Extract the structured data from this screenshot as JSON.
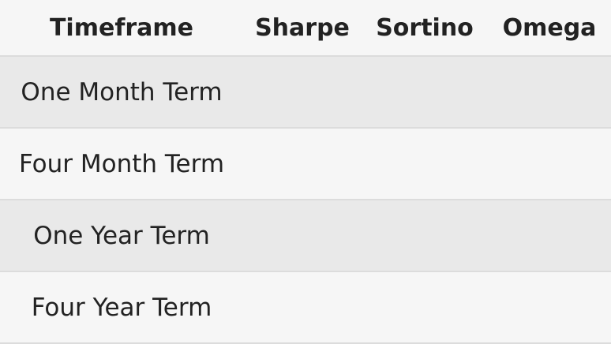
{
  "table": {
    "headers": [
      "Timeframe",
      "Sharpe",
      "Sortino",
      "Omega"
    ],
    "rows": [
      {
        "timeframe": "One Month Term",
        "sharpe": "",
        "sortino": "",
        "omega": ""
      },
      {
        "timeframe": "Four Month Term",
        "sharpe": "",
        "sortino": "",
        "omega": ""
      },
      {
        "timeframe": "One Year Term",
        "sharpe": "",
        "sortino": "",
        "omega": ""
      },
      {
        "timeframe": "Four Year Term",
        "sharpe": "",
        "sortino": "",
        "omega": ""
      }
    ]
  },
  "colors": {
    "row_shaded": "#e9e9e9",
    "row_plain": "#f6f6f6",
    "divider": "#dcdcdc",
    "text": "#222222"
  }
}
